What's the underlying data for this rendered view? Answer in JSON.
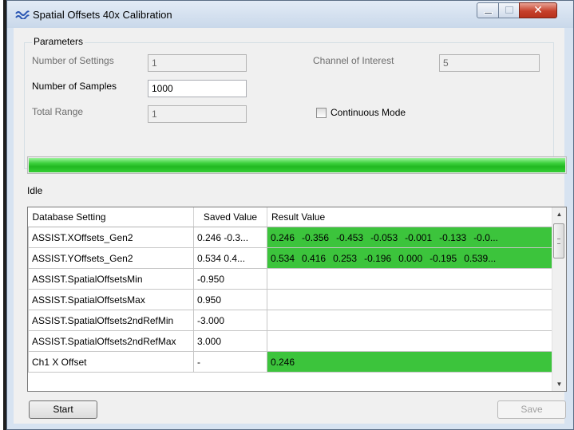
{
  "window": {
    "title": "Spatial Offsets 40x Calibration",
    "icon": "wave-icon"
  },
  "parameters": {
    "legend": "Parameters",
    "number_of_settings_label": "Number of Settings",
    "number_of_settings_value": "1",
    "number_of_samples_label": "Number of Samples",
    "number_of_samples_value": "1000",
    "total_range_label": "Total Range",
    "total_range_value": "1",
    "channel_of_interest_label": "Channel of Interest",
    "channel_of_interest_value": "5",
    "continuous_mode_label": "Continuous Mode",
    "continuous_mode_checked": false
  },
  "progress": {
    "percent": 100,
    "color": "#21b921"
  },
  "status": "Idle",
  "grid": {
    "headers": [
      "Database Setting",
      "Saved Value",
      "Result Value"
    ],
    "rows": [
      {
        "setting": "ASSIST.XOffsets_Gen2",
        "saved": "0.246   -0.3...",
        "result": [
          "0.246",
          "-0.356",
          "-0.453",
          "-0.053",
          "-0.001",
          "-0.133",
          "-0.0..."
        ],
        "highlight": true
      },
      {
        "setting": "ASSIST.YOffsets_Gen2",
        "saved": "0.534   0.4...",
        "result": [
          "0.534",
          "0.416",
          "0.253",
          "-0.196",
          "0.000",
          "-0.195",
          "0.539..."
        ],
        "highlight": true
      },
      {
        "setting": "ASSIST.SpatialOffsetsMin",
        "saved": "-0.950",
        "result": [],
        "highlight": false
      },
      {
        "setting": "ASSIST.SpatialOffsetsMax",
        "saved": "0.950",
        "result": [],
        "highlight": false
      },
      {
        "setting": "ASSIST.SpatialOffsets2ndRefMin",
        "saved": "-3.000",
        "result": [],
        "highlight": false
      },
      {
        "setting": "ASSIST.SpatialOffsets2ndRefMax",
        "saved": "3.000",
        "result": [],
        "highlight": false
      },
      {
        "setting": "Ch1 X Offset",
        "saved": "-",
        "result": [
          "0.246"
        ],
        "highlight": true
      }
    ],
    "highlight_color": "#3cc43c"
  },
  "buttons": {
    "start": "Start",
    "save": "Save"
  }
}
